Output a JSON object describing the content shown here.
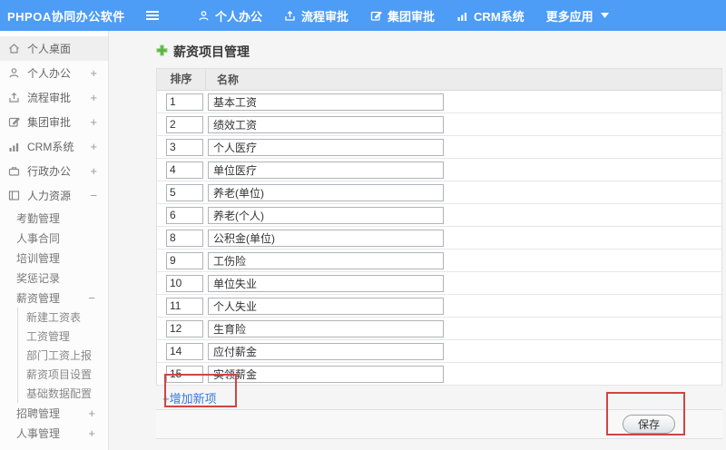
{
  "app": {
    "title": "PHPOA协同办公软件"
  },
  "colors": {
    "navbar_blue": "#4d9cf6",
    "link_blue": "#3a7ad9",
    "annotation_red": "#ce4545",
    "title_plus_green": "#56b44c"
  },
  "topnav": {
    "items": [
      {
        "label": "个人办公",
        "icon": "user-icon"
      },
      {
        "label": "流程审批",
        "icon": "flow-icon"
      },
      {
        "label": "集团审批",
        "icon": "edit-icon"
      },
      {
        "label": "CRM系统",
        "icon": "chart-icon"
      },
      {
        "label": "更多应用",
        "icon": "caret-down-icon"
      }
    ]
  },
  "sidebar": {
    "items": [
      {
        "label": "个人桌面",
        "icon": "home-icon",
        "expand": ""
      },
      {
        "label": "个人办公",
        "icon": "user-icon",
        "expand": "+"
      },
      {
        "label": "流程审批",
        "icon": "flow-icon",
        "expand": "+"
      },
      {
        "label": "集团审批",
        "icon": "edit-icon",
        "expand": "+"
      },
      {
        "label": "CRM系统",
        "icon": "chart-icon",
        "expand": "+"
      },
      {
        "label": "行政办公",
        "icon": "briefcase-icon",
        "expand": "+"
      },
      {
        "label": "人力资源",
        "icon": "hr-icon",
        "expand": "−"
      }
    ],
    "hr_submenu": [
      "考勤管理",
      "人事合同",
      "培训管理",
      "奖惩记录"
    ],
    "salary_group": {
      "label": "薪资管理",
      "expand": "−",
      "children": [
        "新建工资表",
        "工资管理",
        "部门工资上报",
        "薪资项目设置",
        "基础数据配置"
      ]
    },
    "bottom_items": [
      {
        "label": "招聘管理",
        "expand": "+"
      },
      {
        "label": "人事管理",
        "expand": "+"
      }
    ]
  },
  "main": {
    "title": "薪资项目管理",
    "table": {
      "headers": [
        "排序",
        "名称"
      ],
      "rows": [
        {
          "order": "1",
          "name": "基本工资"
        },
        {
          "order": "2",
          "name": "绩效工资"
        },
        {
          "order": "3",
          "name": "个人医疗"
        },
        {
          "order": "4",
          "name": "单位医疗"
        },
        {
          "order": "5",
          "name": "养老(单位)"
        },
        {
          "order": "6",
          "name": "养老(个人)"
        },
        {
          "order": "8",
          "name": "公积金(单位)"
        },
        {
          "order": "9",
          "name": "工伤险"
        },
        {
          "order": "10",
          "name": "单位失业"
        },
        {
          "order": "11",
          "name": "个人失业"
        },
        {
          "order": "12",
          "name": "生育险"
        },
        {
          "order": "14",
          "name": "应付薪金"
        },
        {
          "order": "15",
          "name": "实领薪金"
        }
      ]
    },
    "add_link": "+增加新项",
    "save_button": "保存"
  }
}
